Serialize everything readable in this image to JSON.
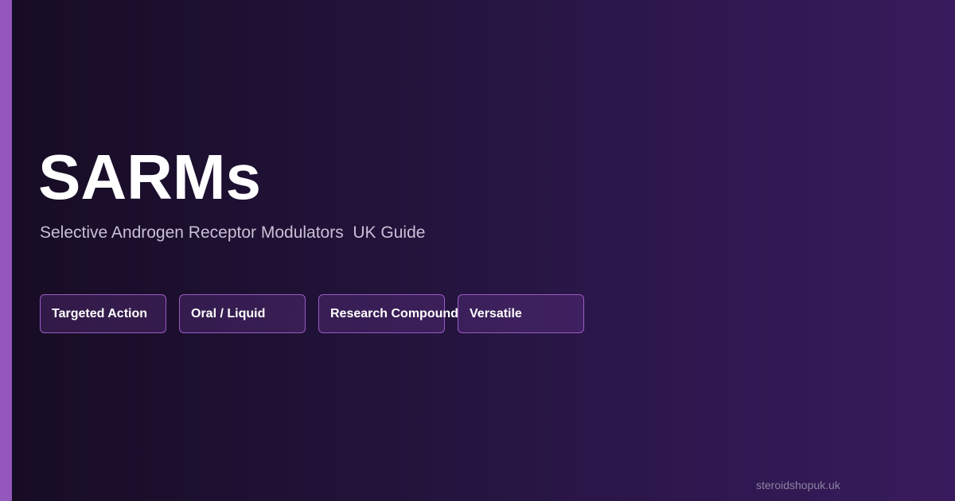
{
  "hero": {
    "title": "SARMs",
    "subtitle": "Selective Androgen Receptor Modulators  UK Guide"
  },
  "tags": [
    {
      "label": "Targeted Action"
    },
    {
      "label": "Oral / Liquid"
    },
    {
      "label": "Research Compound"
    },
    {
      "label": "Versatile"
    }
  ],
  "footer": {
    "site": "steroidshopuk.uk"
  },
  "colors": {
    "accent": "#9457bc",
    "background_start": "#170c24",
    "background_end": "#381b5c",
    "tag_border": "#9a5bc2",
    "title": "#ffffff"
  }
}
